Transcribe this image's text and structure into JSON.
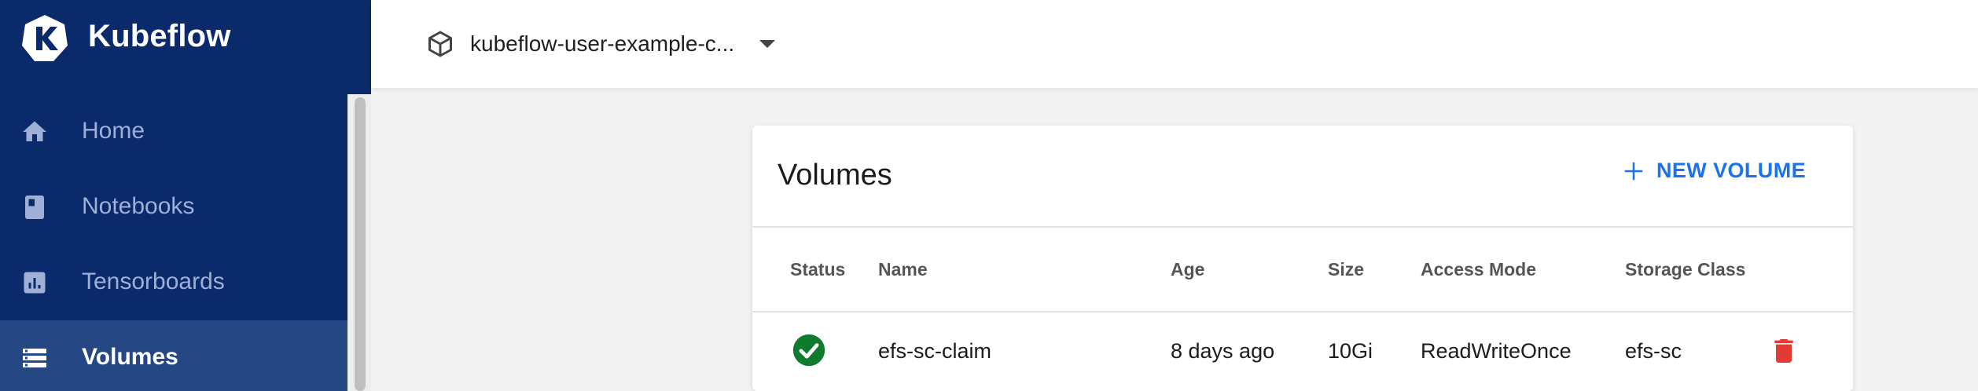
{
  "app": {
    "title": "Kubeflow"
  },
  "sidebar": {
    "items": [
      {
        "label": "Home",
        "icon": "home-icon"
      },
      {
        "label": "Notebooks",
        "icon": "notebook-icon"
      },
      {
        "label": "Tensorboards",
        "icon": "tensorboard-icon"
      },
      {
        "label": "Volumes",
        "icon": "volumes-icon",
        "active": true
      }
    ]
  },
  "topbar": {
    "namespace": "kubeflow-user-example-c..."
  },
  "volumes": {
    "title": "Volumes",
    "new_button": "NEW VOLUME",
    "columns": [
      "Status",
      "Name",
      "Age",
      "Size",
      "Access Mode",
      "Storage Class"
    ],
    "rows": [
      {
        "status": "ready",
        "name": "efs-sc-claim",
        "age": "8 days ago",
        "size": "10Gi",
        "access_mode": "ReadWriteOnce",
        "storage_class": "efs-sc"
      }
    ]
  },
  "colors": {
    "sidebar_bg": "#0a2a6b",
    "sidebar_active": "#254784",
    "accent": "#1a73e8",
    "status_ok": "#0f7b2f",
    "delete": "#e53935"
  }
}
